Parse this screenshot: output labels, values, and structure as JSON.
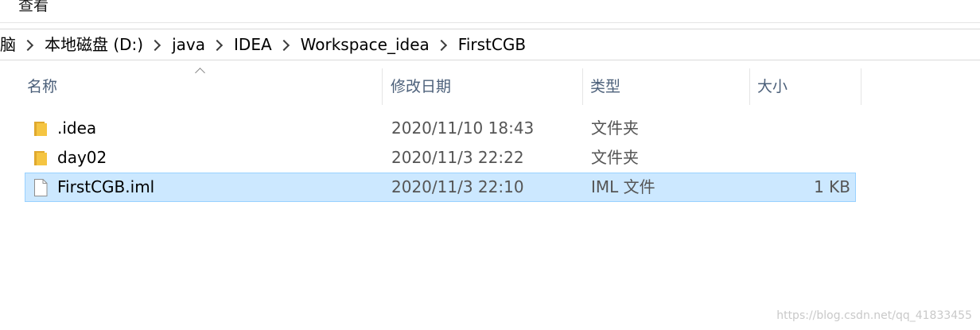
{
  "ribbon": {
    "visible_tab": "查看"
  },
  "breadcrumb": {
    "items": [
      "脑",
      "本地磁盘 (D:)",
      "java",
      "IDEA",
      "Workspace_idea",
      "FirstCGB"
    ]
  },
  "columns": {
    "name": "名称",
    "date": "修改日期",
    "type": "类型",
    "size": "大小"
  },
  "files": [
    {
      "name": ".idea",
      "date": "2020/11/10 18:43",
      "type": "文件夹",
      "size": "",
      "icon": "folder-icon",
      "selected": false
    },
    {
      "name": "day02",
      "date": "2020/11/3 22:22",
      "type": "文件夹",
      "size": "",
      "icon": "folder-icon",
      "selected": false
    },
    {
      "name": "FirstCGB.iml",
      "date": "2020/11/3 22:10",
      "type": "IML 文件",
      "size": "1 KB",
      "icon": "file-icon",
      "selected": true
    }
  ],
  "watermark": "https://blog.csdn.net/qq_41833455",
  "colors": {
    "selection_bg": "#cce8ff",
    "selection_border": "#99d1ff",
    "header_text": "#4c607a",
    "folder_yellow": "#f5c542"
  }
}
